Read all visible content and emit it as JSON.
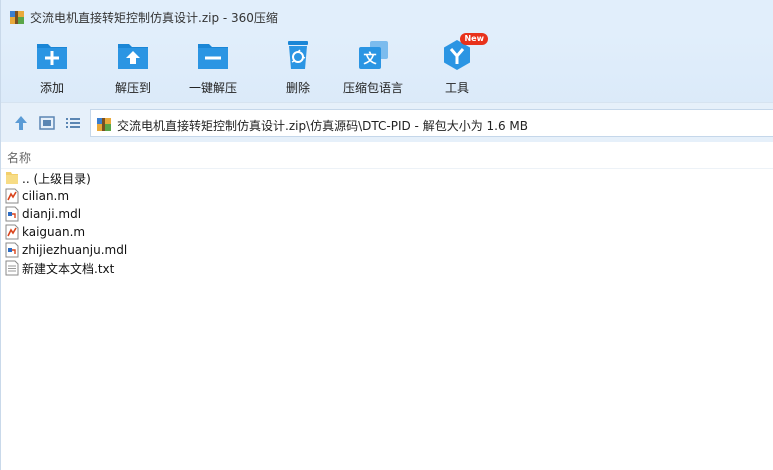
{
  "window": {
    "title": "交流电机直接转矩控制仿真设计.zip - 360压缩"
  },
  "toolbar": {
    "items": [
      {
        "label": "添加",
        "icon": "add-icon"
      },
      {
        "label": "解压到",
        "icon": "extract-to-icon"
      },
      {
        "label": "一键解压",
        "icon": "one-click-extract-icon"
      },
      {
        "label": "删除",
        "icon": "delete-icon"
      },
      {
        "label": "压缩包语言",
        "icon": "language-icon"
      },
      {
        "label": "工具",
        "icon": "tools-icon",
        "badge": "New"
      }
    ]
  },
  "nav": {
    "path": "交流电机直接转矩控制仿真设计.zip\\仿真源码\\DTC-PID - 解包大小为 1.6 MB"
  },
  "list": {
    "column_name": "名称",
    "files": [
      {
        "name": ".. (上级目录)",
        "type": "folder"
      },
      {
        "name": "cilian.m",
        "type": "matlab"
      },
      {
        "name": "dianji.mdl",
        "type": "simulink"
      },
      {
        "name": "kaiguan.m",
        "type": "matlab"
      },
      {
        "name": "zhijiezhuanju.mdl",
        "type": "simulink"
      },
      {
        "name": "新建文本文档.txt",
        "type": "text"
      }
    ]
  },
  "colors": {
    "accent": "#1e88d8",
    "toolbar_bg": "#e1eefb",
    "badge": "#e8321b"
  }
}
